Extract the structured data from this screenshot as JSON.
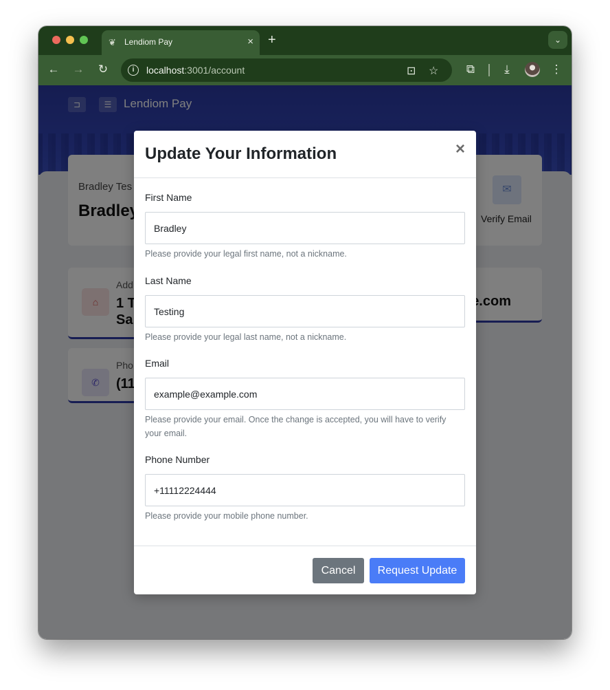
{
  "browser": {
    "tab_title": "Lendiom Pay",
    "tab_close": "×",
    "new_tab": "+",
    "tab_menu": "⌄",
    "url_host": "localhost",
    "url_path": ":3001/account",
    "icons": [
      "back-icon",
      "forward-icon",
      "reload-icon",
      "site-info-icon",
      "install-app-icon",
      "bookmark-star-icon",
      "extensions-icon",
      "download-icon",
      "profile-avatar",
      "menu-icon"
    ]
  },
  "page": {
    "brand": "Lendiom Pay",
    "profile_small": "Bradley Tes",
    "profile_name": "Bradley",
    "verify_email_label": "Verify Email",
    "address_label": "Add",
    "address_line1": "1 T",
    "address_line2": "Sa",
    "email_value_fragment": "e.com",
    "phone_label": "Pho",
    "phone_value": "(11"
  },
  "modal": {
    "title": "Update Your Information",
    "close": "×",
    "fields": [
      {
        "label": "First Name",
        "value": "Bradley",
        "help": "Please provide your legal first name, not a nickname."
      },
      {
        "label": "Last Name",
        "value": "Testing",
        "help": "Please provide your legal last name, not a nickname."
      },
      {
        "label": "Email",
        "value": "example@example.com",
        "help": "Please provide your email. Once the change is accepted, you will have to verify your email."
      },
      {
        "label": "Phone Number",
        "value": "+11112224444",
        "help": "Please provide your mobile phone number."
      }
    ],
    "cancel_label": "Cancel",
    "request_label": "Request Update"
  },
  "colors": {
    "primary": "#4a7cf7",
    "secondary": "#6c757d",
    "hero": "#2b3aa3",
    "browser_frame": "#395d34"
  }
}
